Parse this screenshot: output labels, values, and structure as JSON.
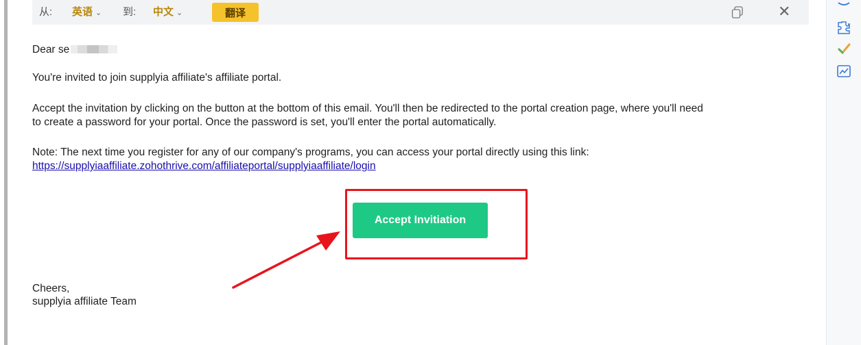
{
  "translate_bar": {
    "from_label": "从:",
    "from_lang": "英语",
    "to_label": "到:",
    "to_lang": "中文",
    "caret": "⌄",
    "translate_button": "翻译",
    "close_glyph": "✕"
  },
  "email": {
    "greeting": "Dear se",
    "invite_line": "You're invited to join supplyia affiliate's affiliate portal.",
    "instructions_line1": "Accept the invitation by clicking on the button at the bottom of this email. You'll then be redirected to the portal creation page, where you'll need",
    "instructions_line2": "to create a password for your portal. Once the password is set, you'll enter the portal automatically.",
    "note_line": "Note: The next time you register for any of our company's programs, you can access your portal directly using this link:",
    "portal_link": "https://supplyiaaffiliate.zohothrive.com/affiliateportal/supplyiaaffiliate/login",
    "accept_button": "Accept Invitiation",
    "signoff": "Cheers,",
    "team": "supplyia affiliate Team"
  },
  "colors": {
    "accept_button": "#1ec985",
    "translate_button": "#f5c22b",
    "highlight": "#e8141c",
    "link": "#1a0dab"
  },
  "icons": [
    "copy-icon",
    "close-icon",
    "puzzle-icon",
    "checkmark-pen-icon",
    "chart-icon",
    "blurred-name",
    "red-arrow-annotation"
  ]
}
